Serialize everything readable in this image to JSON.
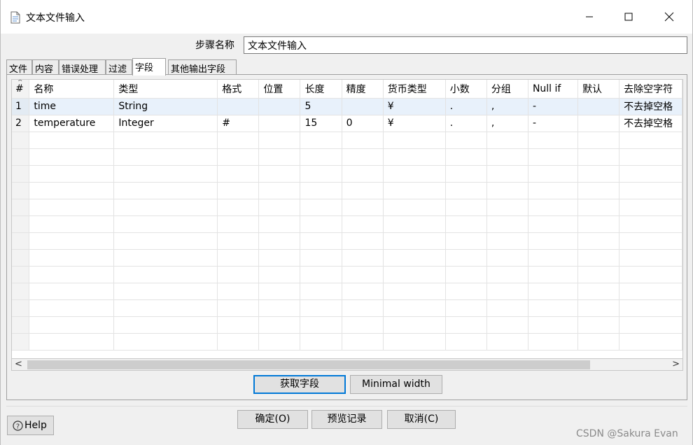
{
  "window": {
    "title": "文本文件输入"
  },
  "step": {
    "label": "步骤名称",
    "value": "文本文件输入"
  },
  "tabs": [
    {
      "label": "文件"
    },
    {
      "label": "内容"
    },
    {
      "label": "错误处理"
    },
    {
      "label": "过滤"
    },
    {
      "label": "字段",
      "active": true
    },
    {
      "label": "其他输出字段"
    }
  ],
  "grid": {
    "columns": [
      "#",
      "名称",
      "类型",
      "格式",
      "位置",
      "长度",
      "精度",
      "货币类型",
      "小数",
      "分组",
      "Null if",
      "默认",
      "去除空字符"
    ],
    "rows": [
      [
        "1",
        "time",
        "String",
        "",
        "",
        "5",
        "",
        "¥",
        ".",
        ",",
        "-",
        "",
        "不去掉空格"
      ],
      [
        "2",
        "temperature",
        "Integer",
        "#",
        "",
        "15",
        "0",
        "¥",
        ".",
        ",",
        "-",
        "",
        "不去掉空格"
      ]
    ],
    "selected_row": 1
  },
  "panel_buttons": {
    "get_fields": "获取字段",
    "minimal_width": "Minimal width"
  },
  "footer": {
    "ok": "确定(O)",
    "preview": "预览记录",
    "cancel": "取消(C)",
    "help": "Help"
  },
  "watermark": "CSDN @Sakura Evan"
}
